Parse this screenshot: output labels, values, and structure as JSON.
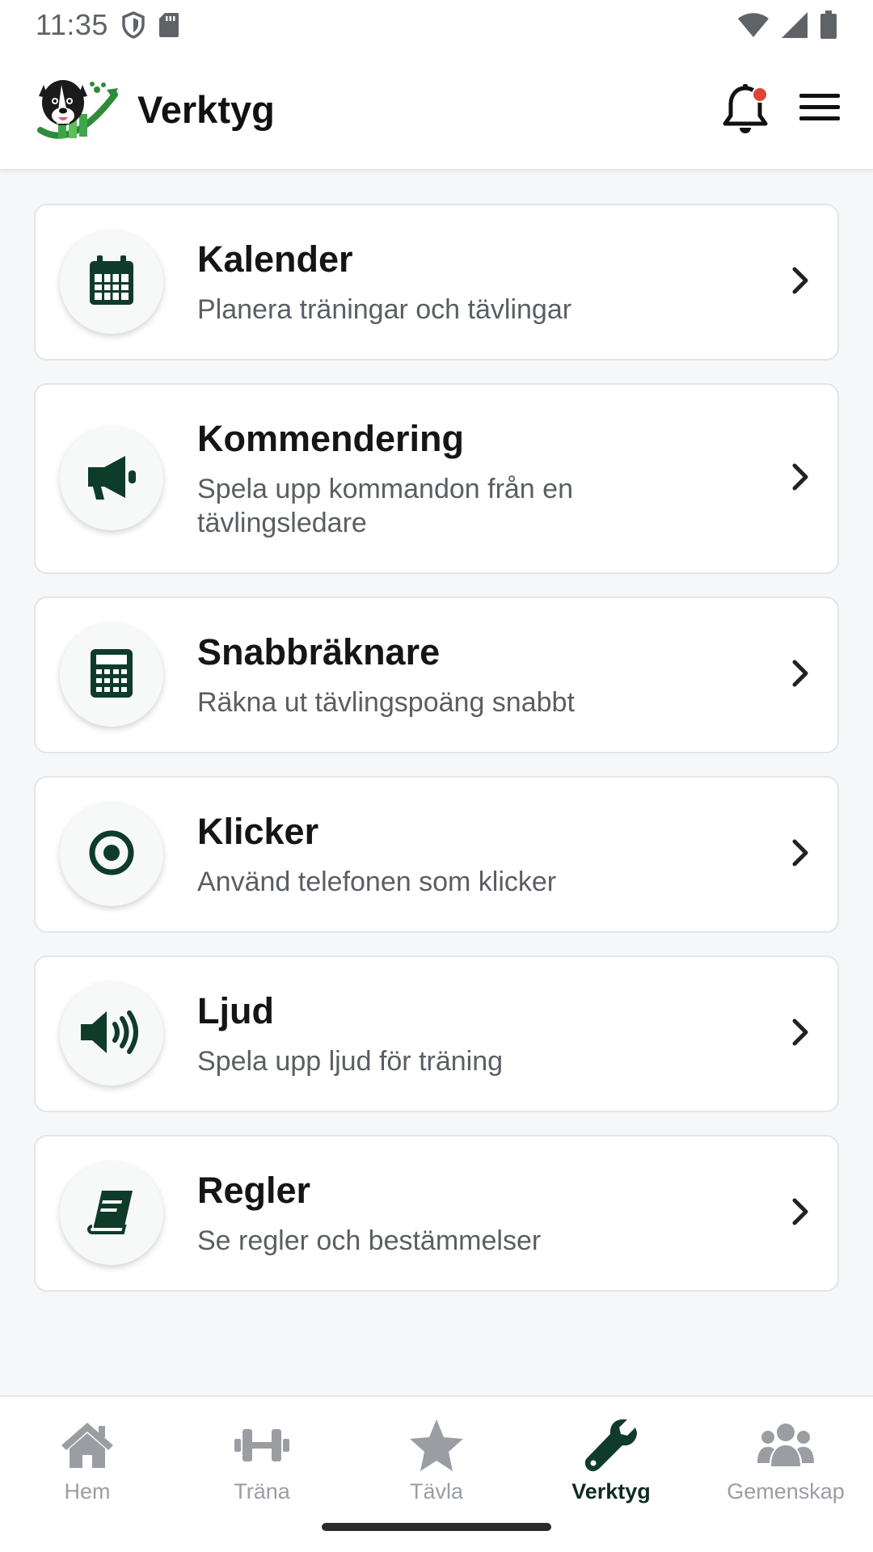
{
  "status_bar": {
    "time": "11:35",
    "icons": [
      "shield-icon",
      "sd-card-icon",
      "wifi-icon",
      "signal-icon",
      "battery-icon"
    ]
  },
  "header": {
    "title": "Verktyg",
    "logo_icon": "dog-logo",
    "notification_icon": "bell-icon",
    "menu_icon": "hamburger-menu-icon",
    "notification_dot_color": "#e0453a"
  },
  "tools": [
    {
      "title": "Kalender",
      "description": "Planera träningar och tävlingar",
      "icon": "calendar-icon"
    },
    {
      "title": "Kommendering",
      "description": "Spela upp kommandon från en tävlingsledare",
      "icon": "megaphone-icon"
    },
    {
      "title": "Snabbräknare",
      "description": "Räkna ut tävlingspoäng snabbt",
      "icon": "calculator-icon"
    },
    {
      "title": "Klicker",
      "description": "Använd telefonen som klicker",
      "icon": "target-icon"
    },
    {
      "title": "Ljud",
      "description": "Spela upp ljud för träning",
      "icon": "speaker-icon"
    },
    {
      "title": "Regler",
      "description": "Se regler och bestämmelser",
      "icon": "book-icon"
    }
  ],
  "bottom_nav": {
    "items": [
      {
        "label": "Hem",
        "icon": "home-icon",
        "active": false
      },
      {
        "label": "Träna",
        "icon": "dumbbell-icon",
        "active": false
      },
      {
        "label": "Tävla",
        "icon": "star-icon",
        "active": false
      },
      {
        "label": "Verktyg",
        "icon": "wrench-icon",
        "active": true
      },
      {
        "label": "Gemenskap",
        "icon": "users-icon",
        "active": false
      }
    ]
  },
  "colors": {
    "accent": "#0f3b2b",
    "inactive": "#9a9ea3",
    "background": "#f6f7f9"
  }
}
